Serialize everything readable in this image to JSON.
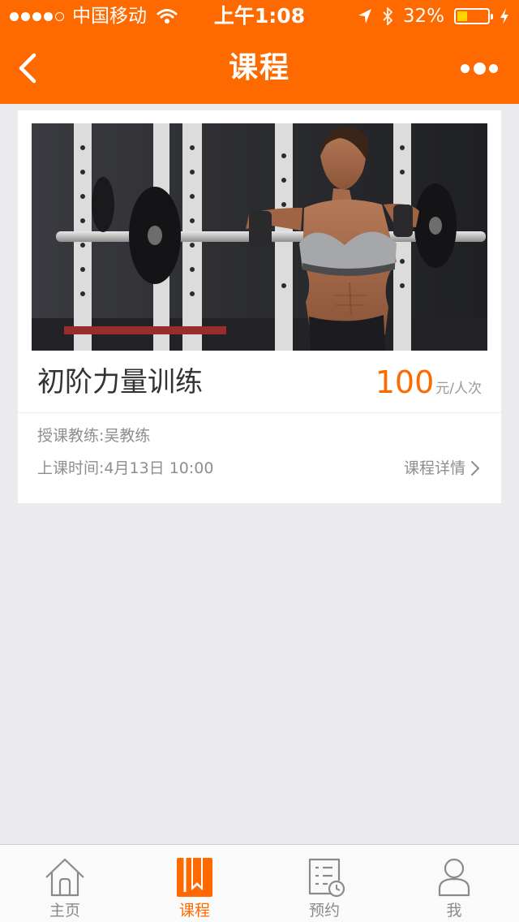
{
  "colors": {
    "accent": "#ff6a00",
    "background": "#ebebed",
    "battery": "#ffd400"
  },
  "status_bar": {
    "carrier": "中国移动",
    "time": "上午1:08",
    "battery_percent": "32%",
    "battery_level": 0.32,
    "signal_bars": 4,
    "icons": [
      "wifi-icon",
      "location-arrow-icon",
      "bluetooth-icon",
      "battery-icon",
      "charging-icon"
    ]
  },
  "nav": {
    "title": "课程",
    "back_icon": "chevron-left-icon",
    "more_icon": "more-dots-icon"
  },
  "course": {
    "name": "初阶力量训练",
    "price": "100",
    "price_unit": "元/人次",
    "coach": "授课教练:吴教练",
    "schedule": "上课时间:4月13日 10:00",
    "detail_label": "课程详情",
    "image": "gym-photo"
  },
  "tabbar": {
    "active": 1,
    "items": [
      {
        "label": "主页",
        "icon": "home-icon"
      },
      {
        "label": "课程",
        "icon": "course-icon"
      },
      {
        "label": "预约",
        "icon": "appointment-icon"
      },
      {
        "label": "我",
        "icon": "user-icon"
      }
    ]
  }
}
